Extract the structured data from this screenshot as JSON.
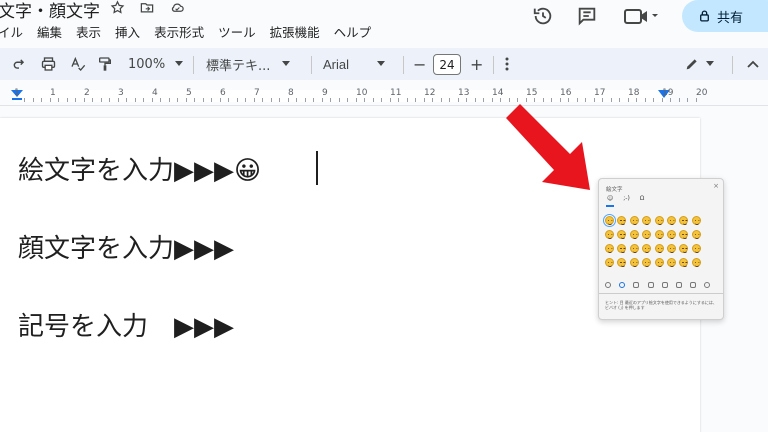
{
  "title": "文字・顔文字",
  "menu": [
    "イル",
    "編集",
    "表示",
    "挿入",
    "表示形式",
    "ツール",
    "拡張機能",
    "ヘルプ"
  ],
  "top_right": {
    "share_label": "共有"
  },
  "toolbar": {
    "zoom": "100%",
    "style": "標準テキ...",
    "font": "Arial",
    "font_size": "24",
    "minus": "−",
    "plus": "+"
  },
  "ruler": {
    "numbers": [
      "1",
      "1",
      "2",
      "3",
      "4",
      "5",
      "6",
      "7",
      "8",
      "9",
      "10",
      "11",
      "12",
      "13",
      "14",
      "15",
      "16",
      "17",
      "18",
      "19",
      "20"
    ]
  },
  "document": {
    "line1": "絵文字を入力▶▶▶😀",
    "line2": "顔文字を入力▶▶▶",
    "line3": "記号を入力　▶▶▶"
  },
  "emoji_panel": {
    "title": "絵文字",
    "close": "×",
    "tabs": [
      "☺",
      ";-)",
      "Ω"
    ],
    "hint": "ヒント: 目 最近のアプリ絵文字を使用できるようにするには、ビバオ (」) を押します"
  },
  "colors": {
    "accent": "#c2e7ff",
    "arrow": "#e8141e",
    "toolbar": "#edf2fa"
  }
}
